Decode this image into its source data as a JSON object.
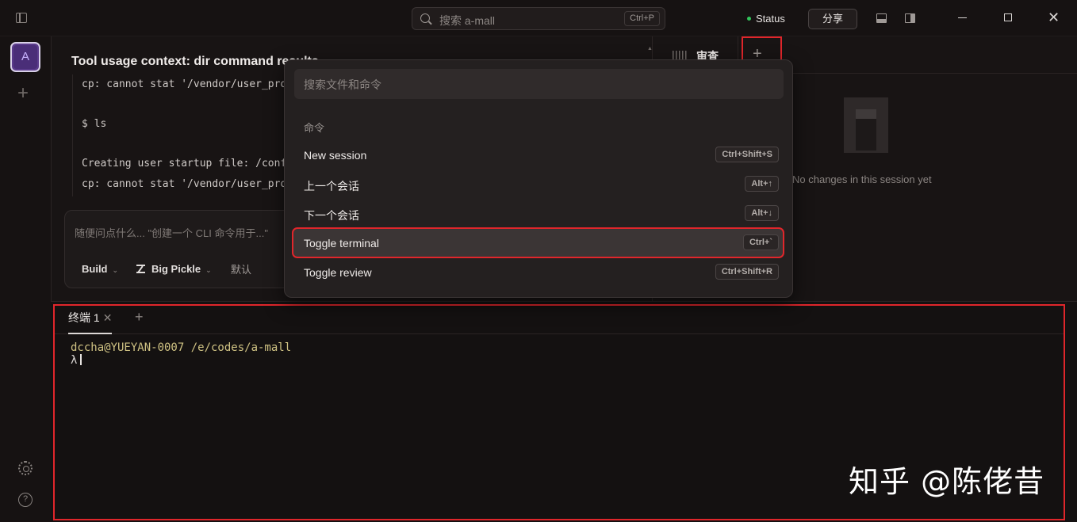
{
  "titlebar": {
    "search_placeholder": "搜索 a-mall",
    "search_shortcut": "Ctrl+P",
    "status_label": "Status",
    "share_label": "分享",
    "close_glyph": "✕"
  },
  "rail": {
    "avatar_letter": "A",
    "add_glyph": "+",
    "help_glyph": "?"
  },
  "main": {
    "title": "Tool usage context: dir command results",
    "code_lines": [
      "cp: cannot stat '/vendor/user_pro",
      "$ ls",
      "Creating user startup file: /conf",
      "cp: cannot stat '/vendor/user_pro"
    ],
    "composer": {
      "placeholder": "随便问点什么... \"创建一个 CLI 命令用于...\"",
      "agent": "Build",
      "model": "Big Pickle",
      "variant": "默认",
      "chevron": "⌄"
    }
  },
  "review": {
    "tab_label": "审查",
    "add_glyph": "+",
    "empty_text": "No changes in this session yet"
  },
  "palette": {
    "search_placeholder": "搜索文件和命令",
    "heading": "命令",
    "items": [
      {
        "label": "New session",
        "shortcut": "Ctrl+Shift+S"
      },
      {
        "label": "上一个会话",
        "shortcut": "Alt+↑"
      },
      {
        "label": "下一个会话",
        "shortcut": "Alt+↓"
      },
      {
        "label": "Toggle terminal",
        "shortcut": "Ctrl+`"
      },
      {
        "label": "Toggle review",
        "shortcut": "Ctrl+Shift+R"
      }
    ]
  },
  "terminal": {
    "tab_label": "终端 1",
    "tab_close": "✕",
    "add_glyph": "+",
    "prompt_path": "dccha@YUEYAN-0007 /e/codes/a-mall",
    "prompt_symbol": "λ"
  },
  "watermark": "知乎 @陈佬昔",
  "colors": {
    "accent_red": "#e0262b",
    "status_green": "#31c45a",
    "avatar_purple": "#5b3b8c"
  }
}
